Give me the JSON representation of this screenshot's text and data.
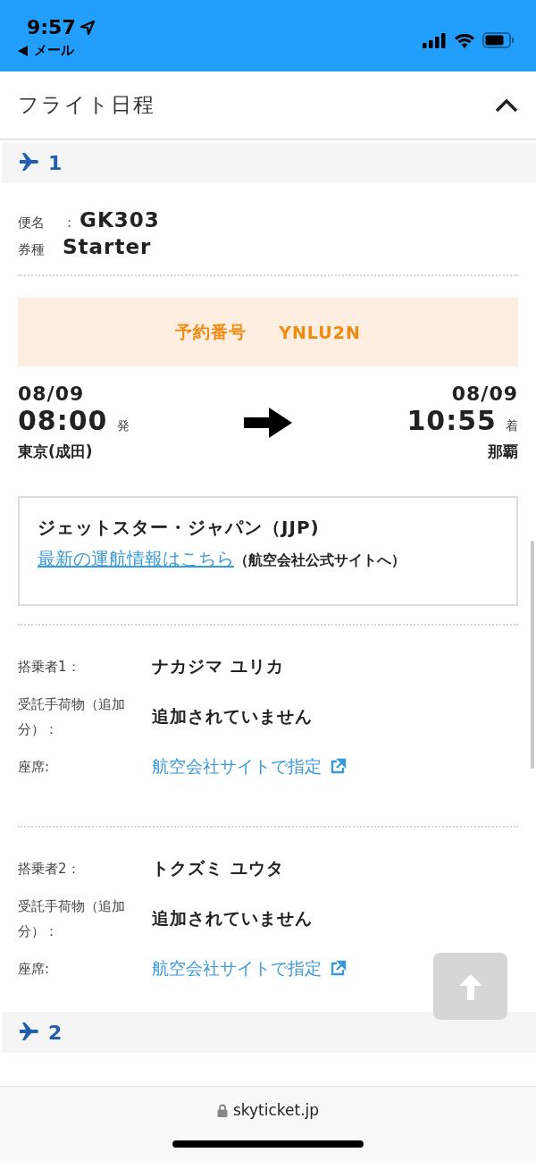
{
  "status_bar": {
    "time": "9:57",
    "back_label": "メール"
  },
  "section": {
    "title": "フライト日程",
    "expanded": true
  },
  "flights": [
    {
      "number": "1",
      "flight_no_label": "便名",
      "separator": "：",
      "flight_no": "GK303",
      "fare_label": "券種",
      "fare": "Starter",
      "booking_label": "予約番号",
      "booking_code": "YNLU2N",
      "departure": {
        "date": "08/09",
        "time": "08:00",
        "suffix": "発",
        "airport": "東京(成田)"
      },
      "arrival": {
        "date": "08/09",
        "time": "10:55",
        "suffix": "着",
        "airport": "那覇"
      },
      "airline": {
        "name": "ジェットスター・ジャパン（JJP)",
        "link": "最新の運航情報はこちら",
        "note": "（航空会社公式サイトへ）"
      },
      "passengers": [
        {
          "rows": [
            {
              "kind": "text",
              "label": "搭乗者1：",
              "value": "ナカジマ ユリカ"
            },
            {
              "kind": "text",
              "label": "受託手荷物（追加分）：",
              "value": "追加されていません"
            },
            {
              "kind": "link",
              "label": "座席:",
              "value": "航空会社サイトで指定"
            }
          ]
        },
        {
          "rows": [
            {
              "kind": "text",
              "label": "搭乗者2：",
              "value": "トクズミ ユウタ"
            },
            {
              "kind": "text",
              "label": "受託手荷物（追加分）：",
              "value": "追加されていません"
            },
            {
              "kind": "link",
              "label": "座席:",
              "value": "航空会社サイトで指定"
            }
          ]
        }
      ]
    },
    {
      "number": "2"
    }
  ],
  "address_bar": {
    "domain": "skyticket.jp"
  }
}
